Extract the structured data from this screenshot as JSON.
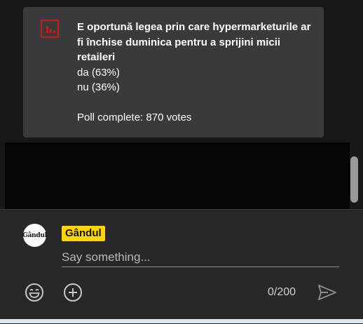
{
  "poll": {
    "icon": "poll-chart-icon",
    "question": "E oportună legea prin care hypermarketurile ar fi închise duminica pentru a sprijini micii retaileri",
    "options": [
      {
        "label": "da (63%)"
      },
      {
        "label": "nu (36%)"
      }
    ],
    "status": "Poll complete: 870 votes"
  },
  "composer": {
    "author_name": "Gândul",
    "avatar_text": "Gândul",
    "input_placeholder": "Say something...",
    "char_count": "0/200",
    "emoji_icon": "emoji-icon",
    "add_icon": "plus-circle-icon",
    "send_icon": "send-icon"
  },
  "colors": {
    "author_chip": "#ffd600",
    "poll_icon": "#c11b1b",
    "card_bg": "#3a3a3a"
  }
}
